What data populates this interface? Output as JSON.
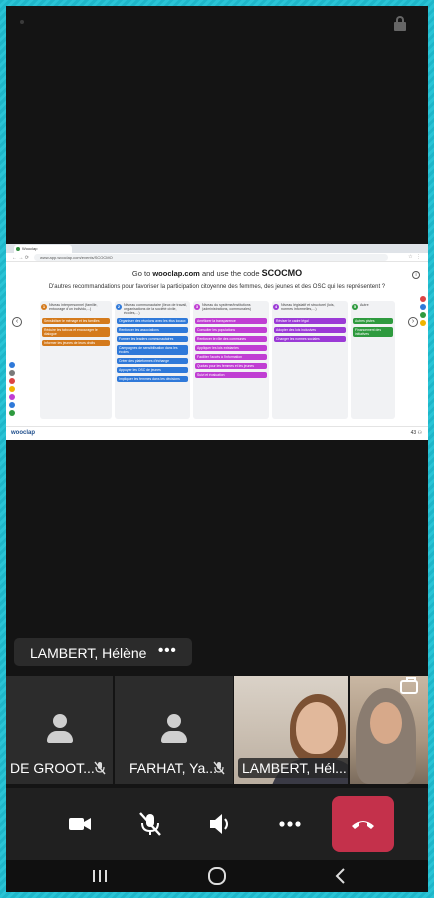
{
  "shared_screen": {
    "browser_tab_title": "Wooclap",
    "address": "www.app.wooclap.com/events/SCOCMO",
    "instructions_prefix": "Go to",
    "instructions_site": "wooclap.com",
    "instructions_middle": "and use the code",
    "event_code": "SCOCMO",
    "question": "D'autres recommandations pour favoriser la participation citoyenne des femmes, des jeunes et des OSC qui les représentent ?",
    "columns": [
      {
        "number": "1",
        "color": "#d47a1c",
        "header": "Niveau interpersonnel (famille, entourage d'un individu,...)",
        "cards": [
          "Sensibiliser le ménage et les familles",
          "Réduire les tabous et encourager le dialogue",
          "Informer les jeunes de leurs droits"
        ]
      },
      {
        "number": "2",
        "color": "#2f79d9",
        "header": "Niveau communautaire (lieux de travail, organisations de la société civile, écoles,...)",
        "cards": [
          "Organiser des réunions avec les élus locaux",
          "Renforcer les associations",
          "Former les leaders communautaires",
          "Campagnes de sensibilisation dans les écoles",
          "Créer des plateformes d'échange",
          "Appuyer les OSC de jeunes",
          "Impliquer les femmes dans les décisions"
        ]
      },
      {
        "number": "3",
        "color": "#c03ed3",
        "header": "Niveau du système/institutions (administrations, communales)",
        "cards": [
          "Améliorer la transparence",
          "Consulter les populations",
          "Renforcer le rôle des communes",
          "Appliquer les lois existantes",
          "Faciliter l'accès à l'information",
          "Quotas pour les femmes et les jeunes",
          "Suivi et évaluation"
        ]
      },
      {
        "number": "4",
        "color": "#9b3ad6",
        "header": "Niveau législatif et structurel (lois, normes informelles,...)",
        "cards": [
          "Réviser le cadre légal",
          "Adopter des lois inclusives",
          "Changer les normes sociales"
        ]
      },
      {
        "number": "5",
        "color": "#2e9a3e",
        "header": "Autre",
        "cards": [
          "Autres pistes",
          "Financement des initiatives"
        ]
      }
    ],
    "brand": "wooclap",
    "participants_count": "43"
  },
  "name_chip": {
    "label": "LAMBERT, Hélène",
    "more": "•••"
  },
  "tiles": [
    {
      "label": "DE GROOT..."
    },
    {
      "label": "FARHAT, Ya..."
    },
    {
      "label": "LAMBERT, Hél..."
    },
    {
      "label": ""
    }
  ],
  "colors": {
    "hangup": "#c4314b",
    "tile_bg": "#2c2c2c",
    "controls_bg": "#202020"
  },
  "icons": {
    "camera": "video-camera-icon",
    "mic": "mic-off-icon",
    "speaker": "speaker-icon",
    "more": "more-icon",
    "hangup": "hang-up-icon"
  }
}
